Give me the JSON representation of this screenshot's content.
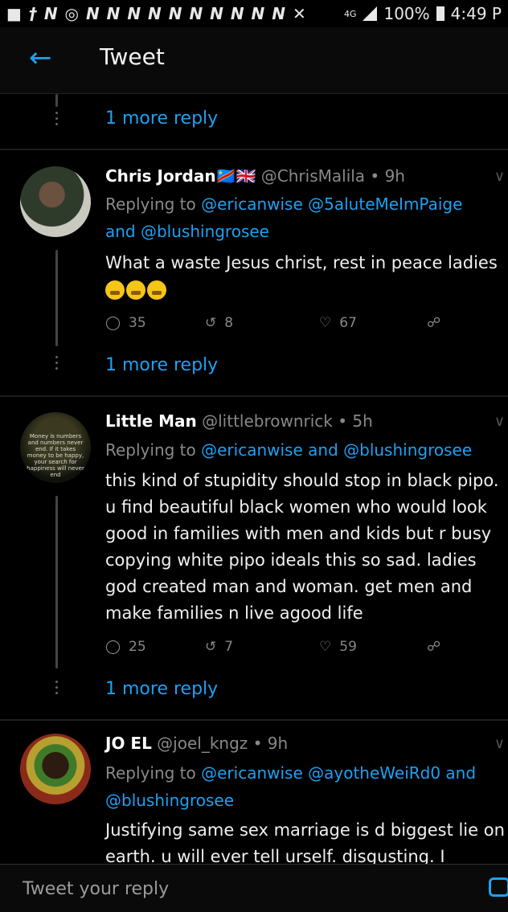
{
  "status_bar": {
    "left_icons": "■ † N ◎ N N N N N N N N N N ✕",
    "network": "4G",
    "battery": "100%",
    "time": "4:49 P"
  },
  "header": {
    "title": "Tweet"
  },
  "threads": [
    {
      "more_reply": "1 more reply"
    },
    {
      "name": "Chris Jordan",
      "flags": "🇨🇩🇬🇧",
      "handle_time": "@ChrisMalila • 9h",
      "replying_prefix": "Replying to ",
      "replying_mentions": "@ericanwise @5aluteMeImPaige",
      "replying_and": "and ",
      "replying_mentions_2": "@blushingrosee",
      "text": "What a waste Jesus christ, rest in peace ladies",
      "replies": "35",
      "retweets": "8",
      "likes": "67",
      "more_reply": "1 more reply"
    },
    {
      "name": "Little Man",
      "handle_time": "@littlebrownrick • 5h",
      "avatar_caption": "Money is numbers and numbers never end. If it takes money to be happy, your search for happiness will never end",
      "replying_prefix": "Replying to ",
      "replying_mentions": "@ericanwise and @blushingrosee",
      "text": "this kind of stupidity should stop in black pipo. u find beautiful black women who would look good in families with men and kids but r busy copying white pipo ideals this so sad. ladies god created man and woman. get men and make families n live agood life",
      "replies": "25",
      "retweets": "7",
      "likes": "59",
      "more_reply": "1 more reply"
    },
    {
      "name": "JO EL",
      "handle_time": "@joel_kngz • 9h",
      "replying_prefix": "Replying to ",
      "replying_mentions": "@ericanwise @ayotheWeiRd0 and",
      "replying_mentions_2": "@blushingrosee",
      "text": "Justifying same sex marriage is d biggest lie on earth. u will ever tell urself. disgusting. I"
    }
  ],
  "reply_bar": {
    "placeholder": "Tweet your reply"
  }
}
